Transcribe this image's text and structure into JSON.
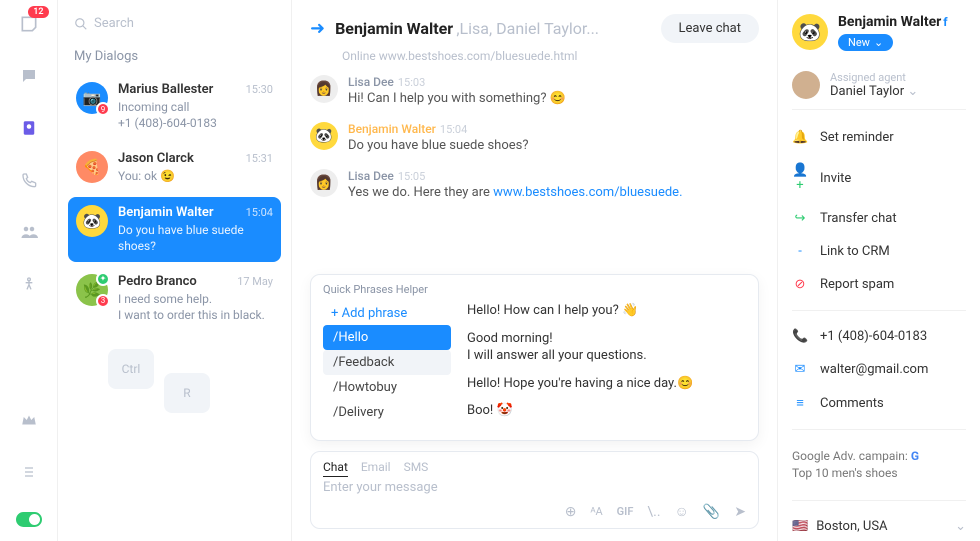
{
  "nav": {
    "inbox_badge": "12"
  },
  "search": {
    "placeholder": "Search"
  },
  "dialogs_title": "My Dialogs",
  "dialogs": [
    {
      "name": "Marius Ballester",
      "time": "15:30",
      "line1": "Incoming call",
      "line2": "+1 (408)-604-0183",
      "badge": "9"
    },
    {
      "name": "Jason Clarck",
      "time": "15:31",
      "line1": "You: ok 😉",
      "line2": ""
    },
    {
      "name": "Benjamin Walter",
      "time": "15:04",
      "line1": "Do you have blue suede shoes?",
      "line2": ""
    },
    {
      "name": "Pedro Branco",
      "time": "17 May",
      "line1": "I need some help.",
      "line2": "I want to order this in black.",
      "badge": "3"
    }
  ],
  "keycaps": {
    "ctrl": "Ctrl",
    "r": "R"
  },
  "chat": {
    "title_main": "Benjamin Walter",
    "title_rest": ",Lisa, Daniel Taylor...",
    "leave": "Leave chat",
    "status_prefix": "Online ",
    "status_url": "www.bestshoes.com/bluesuede.html"
  },
  "messages": [
    {
      "name": "Lisa Dee",
      "time": "15:03",
      "text": "Hi! Can I help you with something? 😊",
      "hl": false
    },
    {
      "name": "Benjamin Walter",
      "time": "15:04",
      "text": "Do you have blue suede shoes?",
      "hl": true
    },
    {
      "name": "Lisa Dee",
      "time": "15:05",
      "text_prefix": "Yes we do. Here they are ",
      "text_link": "www.bestshoes.com/bluesuede.",
      "hl": false
    }
  ],
  "helper": {
    "title": "Quick Phrases Helper",
    "add": "+ Add phrase",
    "items": [
      "/Hello",
      "/Feedback",
      "/Howtobuy",
      "/Delivery"
    ],
    "suggestions": [
      "Hello! How can I help you? 👋",
      "Good morning!\nI will answer all your questions.",
      "Hello! Hope you're having a nice day.😊",
      "Boo! 🤡"
    ]
  },
  "composer": {
    "tabs": {
      "chat": "Chat",
      "email": "Email",
      "sms": "SMS"
    },
    "placeholder": "Enter your message",
    "gif": "GIF"
  },
  "info": {
    "name": "Benjamin Walter",
    "new": "New",
    "agent_label": "Assigned agent",
    "agent_name": "Daniel Taylor",
    "actions": {
      "reminder": "Set reminder",
      "invite": "Invite",
      "transfer": "Transfer chat",
      "crm": "Link to CRM",
      "spam": "Report spam"
    },
    "phone": "+1 (408)-604-0183",
    "email": "walter@gmail.com",
    "comments": "Comments",
    "campaign_label": "Google Adv. campain:",
    "campaign_value": "Top 10 men's shoes",
    "location": "Boston, USA"
  }
}
